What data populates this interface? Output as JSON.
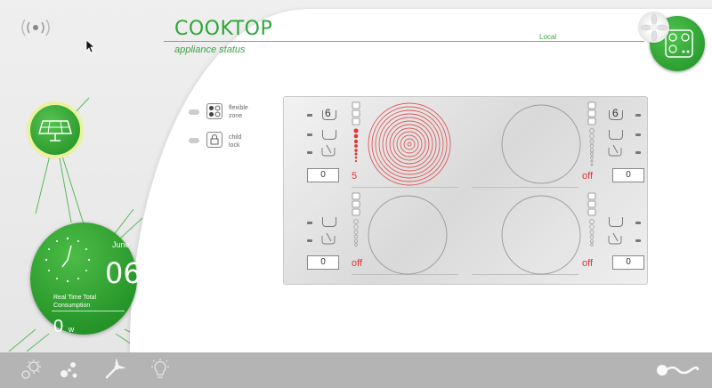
{
  "header": {
    "title": "COOKTOP",
    "subtitle": "appliance status",
    "mode": "Local"
  },
  "legend": {
    "flexible_zone": "flexible\nzone",
    "flexible_zone_line1": "flexible",
    "flexible_zone_line2": "zone",
    "child_lock_line1": "child",
    "child_lock_line2": "lock"
  },
  "zones": {
    "top_left": {
      "timer": "0",
      "status": "5",
      "level_label": "6",
      "active": true,
      "power_level": 5
    },
    "top_right": {
      "timer": "0",
      "status": "off",
      "level_label": "6",
      "active": false
    },
    "bottom_left": {
      "timer": "0",
      "status": "off",
      "active": false
    },
    "bottom_right": {
      "timer": "0",
      "status": "off",
      "active": false
    }
  },
  "clock": {
    "month": "June",
    "day": "06",
    "consumption_label_1": "Real Time Total",
    "consumption_label_2": "Consumption",
    "consumption_value": "0",
    "consumption_unit": "w"
  },
  "colors": {
    "accent_green": "#2fa63a",
    "active_red": "#e63232",
    "bottom_bar": "#b4b4b4"
  },
  "icons": {
    "wifi": "signal-icon",
    "solar": "solar-panel-icon",
    "cooktop": "cooktop-icon",
    "settings": "gear-icon",
    "network": "network-icon",
    "tools": "wrench-icon",
    "light": "bulb-icon",
    "logo": "logo-icon"
  }
}
